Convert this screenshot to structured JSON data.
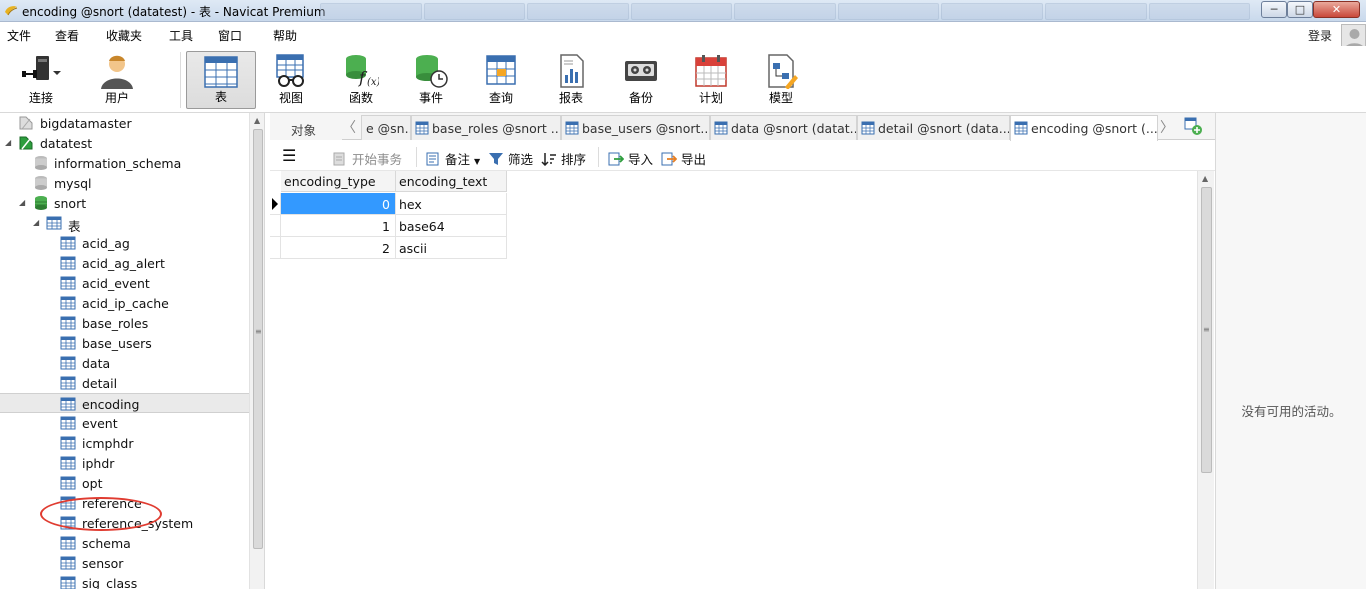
{
  "window": {
    "title": "encoding @snort (datatest) - 表 - Navicat Premium",
    "minimize": "─",
    "maximize": "□",
    "close": "✕"
  },
  "menu": [
    "文件",
    "查看",
    "收藏夹",
    "工具",
    "窗口",
    "帮助"
  ],
  "login": "登录",
  "toolbar": [
    {
      "label": "连接",
      "icon": "connection-icon"
    },
    {
      "label": "用户",
      "icon": "user-icon"
    },
    {
      "label": "表",
      "icon": "table-icon",
      "active": true
    },
    {
      "label": "视图",
      "icon": "view-icon"
    },
    {
      "label": "函数",
      "icon": "function-icon"
    },
    {
      "label": "事件",
      "icon": "event-icon"
    },
    {
      "label": "查询",
      "icon": "query-icon"
    },
    {
      "label": "报表",
      "icon": "report-icon"
    },
    {
      "label": "备份",
      "icon": "backup-icon"
    },
    {
      "label": "计划",
      "icon": "schedule-icon"
    },
    {
      "label": "模型",
      "icon": "model-icon"
    }
  ],
  "tree": {
    "connections": [
      "bigdatamaster",
      "datatest"
    ],
    "databases": [
      "information_schema",
      "mysql",
      "snort"
    ],
    "tables_folder": "表",
    "tables": [
      "acid_ag",
      "acid_ag_alert",
      "acid_event",
      "acid_ip_cache",
      "base_roles",
      "base_users",
      "data",
      "detail",
      "encoding",
      "event",
      "icmphdr",
      "iphdr",
      "opt",
      "reference",
      "reference_system",
      "schema",
      "sensor",
      "sig_class"
    ],
    "selected": "encoding"
  },
  "tabs": {
    "objects": "对象",
    "items": [
      "e @sn...",
      "base_roles @snort ...",
      "base_users @snort...",
      "data @snort (datat...",
      "detail @snort (data...",
      "encoding @snort (..."
    ]
  },
  "objbar": {
    "begin_transaction": "开始事务",
    "memo": "备注",
    "filter": "筛选",
    "sort": "排序",
    "import": "导入",
    "export": "导出"
  },
  "grid": {
    "columns": [
      "encoding_type",
      "encoding_text"
    ],
    "rows": [
      [
        "0",
        "hex"
      ],
      [
        "1",
        "base64"
      ],
      [
        "2",
        "ascii"
      ]
    ]
  },
  "right_panel": {
    "empty_text": "没有可用的活动。"
  },
  "colors": {
    "selection": "#3399ff",
    "annotation_circle": "#e03c31"
  }
}
